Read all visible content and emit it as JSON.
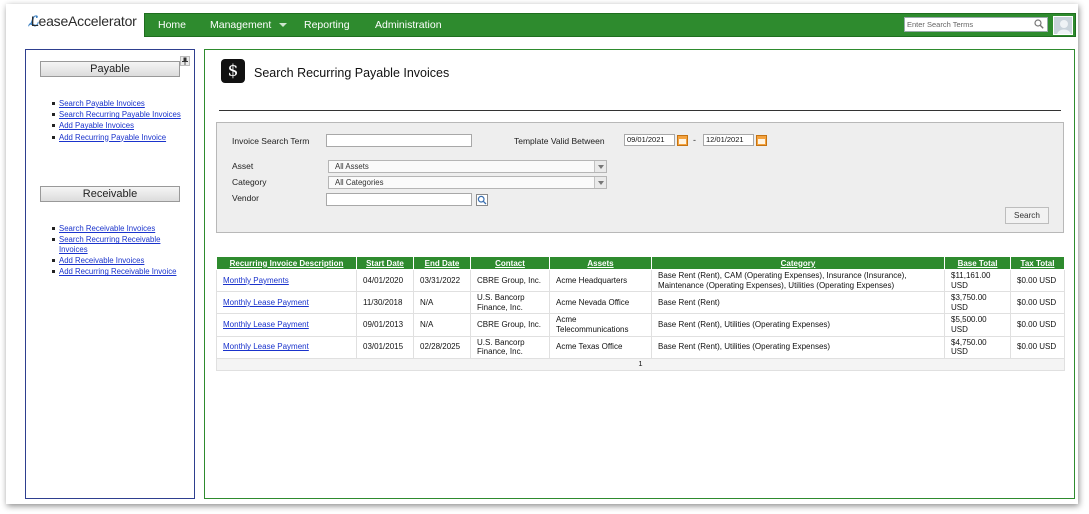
{
  "app": {
    "logo_text": "LeaseAccelerator"
  },
  "nav": {
    "items": [
      {
        "label": "Home"
      },
      {
        "label": "Management",
        "has_dropdown": true
      },
      {
        "label": "Reporting"
      },
      {
        "label": "Administration"
      }
    ],
    "search_placeholder": "Enter Search Terms"
  },
  "sidebar": {
    "payable_heading": "Payable",
    "payable_links": [
      "Search Payable Invoices",
      "Search Recurring Payable Invoices",
      "Add Payable Invoices",
      "Add Recurring Payable Invoice"
    ],
    "receivable_heading": "Receivable",
    "receivable_links": [
      "Search Receivable Invoices",
      "Search Recurring Receivable Invoices",
      "Add Receivable Invoices",
      "Add Recurring Receivable Invoice"
    ]
  },
  "page": {
    "icon_glyph": "$",
    "title": "Search Recurring Payable Invoices"
  },
  "search_form": {
    "invoice_search_term_label": "Invoice Search Term",
    "invoice_search_term_value": "",
    "template_valid_between_label": "Template Valid Between",
    "date_from": "09/01/2021",
    "date_separator": "-",
    "date_to": "12/01/2021",
    "asset_label": "Asset",
    "asset_selected": "All Assets",
    "category_label": "Category",
    "category_selected": "All Categories",
    "vendor_label": "Vendor",
    "vendor_value": "",
    "search_button": "Search"
  },
  "results": {
    "columns": [
      "Recurring Invoice Description",
      "Start Date",
      "End Date",
      "Contact",
      "Assets",
      "Category",
      "Base Total",
      "Tax Total"
    ],
    "rows": [
      {
        "description": "Monthly Payments",
        "start_date": "04/01/2020",
        "end_date": "03/31/2022",
        "contact": "CBRE Group, Inc.",
        "assets": "Acme Headquarters",
        "category": "Base Rent (Rent), CAM (Operating Expenses), Insurance (Insurance), Maintenance (Operating Expenses), Utilities (Operating Expenses)",
        "base_total": "$11,161.00 USD",
        "tax_total": "$0.00 USD"
      },
      {
        "description": "Monthly Lease Payment",
        "start_date": "11/30/2018",
        "end_date": "N/A",
        "contact": "U.S. Bancorp Finance, Inc.",
        "assets": "Acme Nevada Office",
        "category": "Base Rent (Rent)",
        "base_total": "$3,750.00 USD",
        "tax_total": "$0.00 USD"
      },
      {
        "description": "Monthly Lease Payment",
        "start_date": "09/01/2013",
        "end_date": "N/A",
        "contact": "CBRE Group, Inc.",
        "assets": "Acme Telecommunications",
        "category": "Base Rent (Rent), Utilities (Operating Expenses)",
        "base_total": "$5,500.00 USD",
        "tax_total": "$0.00 USD"
      },
      {
        "description": "Monthly Lease Payment",
        "start_date": "03/01/2015",
        "end_date": "02/28/2025",
        "contact": "U.S. Bancorp Finance, Inc.",
        "assets": "Acme Texas Office",
        "category": "Base Rent (Rent), Utilities (Operating Expenses)",
        "base_total": "$4,750.00 USD",
        "tax_total": "$0.00 USD"
      }
    ],
    "pager_current": "1"
  },
  "colors": {
    "nav_green": "#2e8b2e",
    "sidebar_border": "#2e3f8f",
    "link_blue": "#1a33cc",
    "calendar_orange": "#f4a340"
  }
}
